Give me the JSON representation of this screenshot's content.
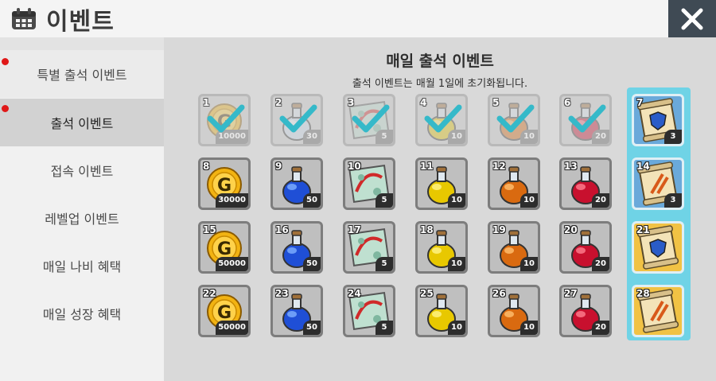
{
  "header": {
    "title": "이벤트",
    "icon": "calendar-icon"
  },
  "close": {
    "icon": "close-icon"
  },
  "sidebar": {
    "items": [
      {
        "label": "특별 출석 이벤트",
        "dot": true
      },
      {
        "label": "출석 이벤트",
        "dot": true
      },
      {
        "label": "접속 이벤트",
        "dot": false
      },
      {
        "label": "레벨업 이벤트",
        "dot": false
      },
      {
        "label": "매일 나비 혜택",
        "dot": false
      },
      {
        "label": "매일 성장 혜택",
        "dot": false
      }
    ],
    "active_index": 1
  },
  "main": {
    "title": "매일 출석 이벤트",
    "subtitle": "출석 이벤트는 매월 1일에 초기화됩니다."
  },
  "rewards": [
    {
      "day": "1",
      "item": "gold-coin",
      "qty": "10000",
      "claimed": true
    },
    {
      "day": "2",
      "item": "bottle-empty",
      "qty": "30",
      "claimed": true
    },
    {
      "day": "3",
      "item": "map",
      "qty": "5",
      "claimed": true
    },
    {
      "day": "4",
      "item": "potion-yellow",
      "qty": "10",
      "claimed": true
    },
    {
      "day": "5",
      "item": "potion-orange",
      "qty": "10",
      "claimed": true
    },
    {
      "day": "6",
      "item": "potion-red",
      "qty": "20",
      "claimed": true
    },
    {
      "day": "7",
      "item": "scroll-shield",
      "qty": "3",
      "claimed": false,
      "special": "blue"
    },
    {
      "day": "8",
      "item": "gold-coin",
      "qty": "30000",
      "claimed": false
    },
    {
      "day": "9",
      "item": "potion-blue",
      "qty": "50",
      "claimed": false
    },
    {
      "day": "10",
      "item": "map",
      "qty": "5",
      "claimed": false
    },
    {
      "day": "11",
      "item": "potion-yellow",
      "qty": "10",
      "claimed": false
    },
    {
      "day": "12",
      "item": "potion-orange",
      "qty": "10",
      "claimed": false
    },
    {
      "day": "13",
      "item": "potion-red",
      "qty": "20",
      "claimed": false
    },
    {
      "day": "14",
      "item": "scroll-sword",
      "qty": "3",
      "claimed": false,
      "special": "blue"
    },
    {
      "day": "15",
      "item": "gold-coin",
      "qty": "50000",
      "claimed": false
    },
    {
      "day": "16",
      "item": "potion-blue",
      "qty": "50",
      "claimed": false
    },
    {
      "day": "17",
      "item": "map",
      "qty": "5",
      "claimed": false
    },
    {
      "day": "18",
      "item": "potion-yellow",
      "qty": "10",
      "claimed": false
    },
    {
      "day": "19",
      "item": "potion-orange",
      "qty": "10",
      "claimed": false
    },
    {
      "day": "20",
      "item": "potion-red",
      "qty": "20",
      "claimed": false
    },
    {
      "day": "21",
      "item": "scroll-shield",
      "qty": "",
      "claimed": false,
      "special": "gold"
    },
    {
      "day": "22",
      "item": "gold-coin",
      "qty": "50000",
      "claimed": false
    },
    {
      "day": "23",
      "item": "potion-blue",
      "qty": "50",
      "claimed": false
    },
    {
      "day": "24",
      "item": "map",
      "qty": "5",
      "claimed": false
    },
    {
      "day": "25",
      "item": "potion-yellow",
      "qty": "10",
      "claimed": false
    },
    {
      "day": "26",
      "item": "potion-orange",
      "qty": "10",
      "claimed": false
    },
    {
      "day": "27",
      "item": "potion-red",
      "qty": "20",
      "claimed": false
    },
    {
      "day": "28",
      "item": "scroll-sword",
      "qty": "",
      "claimed": false,
      "special": "gold"
    }
  ],
  "colors": {
    "claimed_check": "#35b9c9",
    "special_column": "#6fd3e6",
    "sidebar_dot": "#e01818",
    "close_bg": "#3f4a54"
  }
}
